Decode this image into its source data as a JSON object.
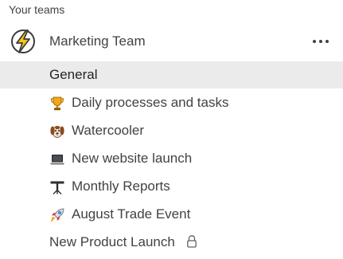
{
  "sidebar": {
    "section_label": "Your teams",
    "team": {
      "name": "Marketing Team",
      "avatar_icon": "lightning-bolt-icon",
      "more_icon": "more-options-icon"
    },
    "channels": [
      {
        "label": "General",
        "icon": "",
        "selected": true
      },
      {
        "label": "Daily processes and tasks",
        "icon": "trophy-icon",
        "selected": false
      },
      {
        "label": "Watercooler",
        "icon": "dog-icon",
        "selected": false
      },
      {
        "label": "New website launch",
        "icon": "laptop-icon",
        "selected": false
      },
      {
        "label": "Monthly Reports",
        "icon": "projector-icon",
        "selected": false
      },
      {
        "label": "August Trade Event",
        "icon": "rocket-icon",
        "selected": false
      },
      {
        "label": "New Product Launch",
        "icon": "lock-icon",
        "selected": false,
        "private": true
      }
    ]
  },
  "colors": {
    "selected_row_bg": "#ebebeb",
    "text": "#424242",
    "avatar_accent": "#f5c518"
  }
}
